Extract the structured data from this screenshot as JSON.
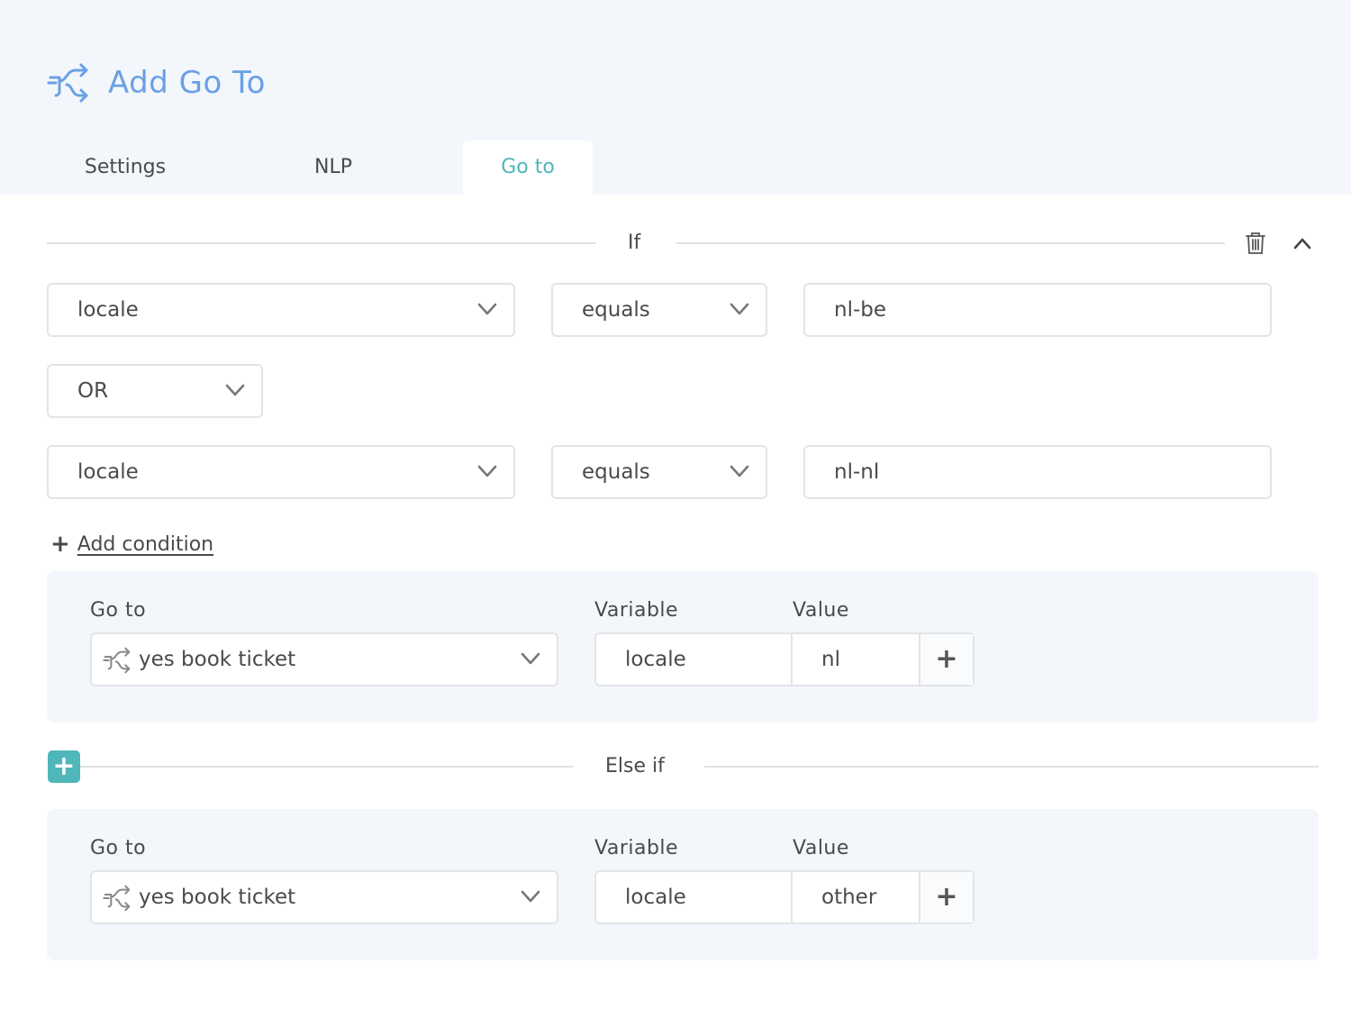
{
  "header": {
    "title": "Add Go To",
    "accent_color": "#6aa0e6",
    "icon": "goto-icon"
  },
  "tabs": [
    {
      "label": "Settings",
      "active": false
    },
    {
      "label": "NLP",
      "active": false
    },
    {
      "label": "Go to",
      "active": true
    }
  ],
  "tab_active_color": "#4fb6b9",
  "if_block": {
    "label": "If",
    "conditions": [
      {
        "field": "locale",
        "operator": "equals",
        "value": "nl-be"
      },
      {
        "field": "locale",
        "operator": "equals",
        "value": "nl-nl"
      }
    ],
    "joiner": "OR",
    "add_condition_label": "Add condition",
    "delete_icon": "trash-icon",
    "collapse_icon": "chevron-up-icon",
    "action": {
      "goto_label": "Go to",
      "goto_value": "yes book ticket",
      "variable_label": "Variable",
      "value_label": "Value",
      "variable": "locale",
      "value": "nl",
      "add_symbol": "+"
    }
  },
  "else_if_block": {
    "label": "Else if",
    "add_symbol": "+",
    "accent_color": "#4fb6b9",
    "action": {
      "goto_label": "Go to",
      "goto_value": "yes book ticket",
      "variable_label": "Variable",
      "value_label": "Value",
      "variable": "locale",
      "value": "other",
      "add_symbol": "+"
    }
  }
}
